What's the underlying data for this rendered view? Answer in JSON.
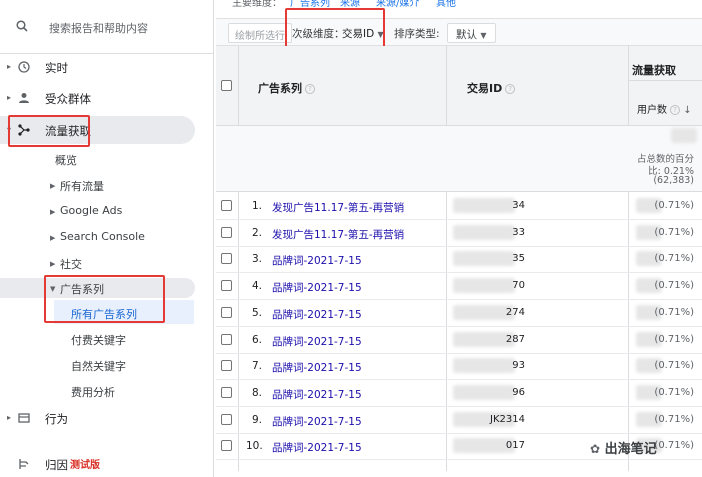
{
  "search": {
    "placeholder": "搜索报告和帮助内容",
    "icon": "search-icon"
  },
  "nav": [
    {
      "label": "实时",
      "icon": "clock-icon"
    },
    {
      "label": "受众群体",
      "icon": "person-icon"
    },
    {
      "label": "流量获取",
      "icon": "acquisition-icon"
    },
    {
      "label": "行为",
      "icon": "behavior-icon"
    },
    {
      "label": "归因",
      "icon": "attribution-icon",
      "badge": "测试版"
    }
  ],
  "acquisition": {
    "overview": "概览",
    "all_traffic": "所有流量",
    "google_ads": "Google Ads",
    "search_console": "Search Console",
    "social": "社交",
    "campaigns": "广告系列",
    "campaign_children": [
      "所有广告系列",
      "付费关键字",
      "自然关键字",
      "费用分析"
    ]
  },
  "topstrip": [
    "主要维度：",
    "广告系列",
    "来源",
    "来源/媒介",
    "其他"
  ],
  "toolbar": {
    "plot_rows": "绘制所选行",
    "secondary_dim_label": "次级维度：",
    "secondary_dim_value": "交易ID",
    "sort_label": "排序类型:",
    "sort_value": "默认"
  },
  "table": {
    "col_campaign": "广告系列",
    "col_txid": "交易ID",
    "group_header": "流量获取",
    "col_users": "用户数",
    "summary": [
      "占总数的百分",
      "比: 0.21%",
      "(62,383)"
    ],
    "rows": [
      {
        "n": "1.",
        "campaign": "发现广告11.17-第五-再营销",
        "txid": "34",
        "pct": "(0.71%)"
      },
      {
        "n": "2.",
        "campaign": "发现广告11.17-第五-再营销",
        "txid": "33",
        "pct": "(0.71%)"
      },
      {
        "n": "3.",
        "campaign": "品牌词-2021-7-15",
        "txid": "35",
        "pct": "(0.71%)"
      },
      {
        "n": "4.",
        "campaign": "品牌词-2021-7-15",
        "txid": "70",
        "pct": "(0.71%)"
      },
      {
        "n": "5.",
        "campaign": "品牌词-2021-7-15",
        "txid": "274",
        "pct": "(0.71%)"
      },
      {
        "n": "6.",
        "campaign": "品牌词-2021-7-15",
        "txid": "287",
        "pct": "(0.71%)"
      },
      {
        "n": "7.",
        "campaign": "品牌词-2021-7-15",
        "txid": "93",
        "pct": "(0.71%)"
      },
      {
        "n": "8.",
        "campaign": "品牌词-2021-7-15",
        "txid": "96",
        "pct": "(0.71%)"
      },
      {
        "n": "9.",
        "campaign": "品牌词-2021-7-15",
        "txid": "JK2314",
        "pct": "(0.71%)"
      },
      {
        "n": "10.",
        "campaign": "品牌词-2021-7-15",
        "txid": "017",
        "pct": "(0.71%)"
      }
    ]
  },
  "watermark": "出海笔记",
  "colors": {
    "link": "#1a0dab",
    "highlight": "#e53935",
    "accent": "#1a73e8"
  }
}
